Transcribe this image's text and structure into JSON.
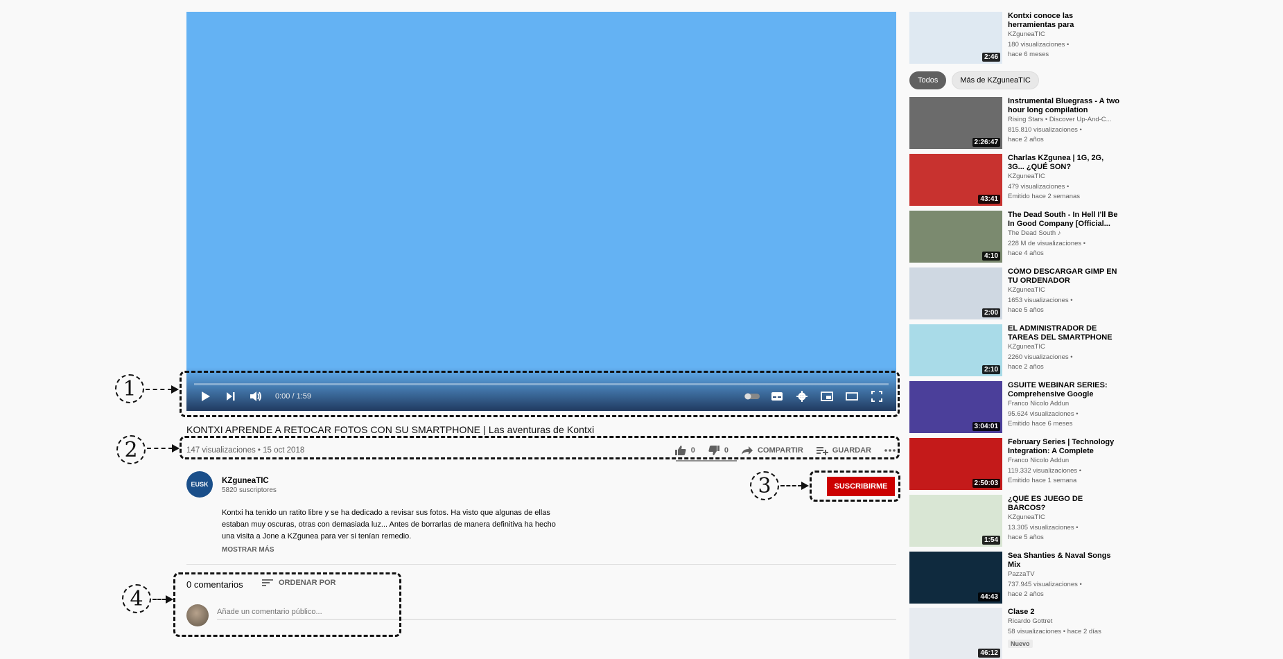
{
  "player": {
    "time": "0:00 / 1:59",
    "progress": 0
  },
  "video": {
    "title": "KONTXI APRENDE A RETOCAR FOTOS CON SU SMARTPHONE | Las aventuras de Kontxi",
    "views_date": "147 visualizaciones • 15 oct 2018",
    "likes": "0",
    "dislikes": "0",
    "share_label": "COMPARTIR",
    "save_label": "GUARDAR"
  },
  "channel": {
    "name": "KZguneaTIC",
    "subscribers": "5820 suscriptores",
    "avatar_text": "EUSK",
    "subscribe_label": "SUSCRIBIRME"
  },
  "description": {
    "text": "Kontxi ha tenido un ratito libre y se ha dedicado a revisar sus fotos. Ha visto que algunas de ellas estaban muy oscuras, otras con demasiada luz... Antes de borrarlas de manera definitiva ha hecho una visita a Jone a KZgunea para ver si tenían remedio.",
    "more_label": "MOSTRAR MÁS"
  },
  "comments": {
    "count_label": "0 comentarios",
    "sort_label": "ORDENAR POR",
    "placeholder": "Añade un comentario público..."
  },
  "annotations": [
    "1",
    "2",
    "3",
    "4"
  ],
  "chips": [
    "Todos",
    "Más de KZguneaTIC"
  ],
  "recommendations": [
    {
      "title": "Kontxi conoce las herramientas para comunicación no...",
      "channel": "KZguneaTIC",
      "views": "180 visualizaciones •",
      "age": "hace 6 meses",
      "duration": "2:46",
      "color": "#dfe9f2"
    },
    {
      "title": "Instrumental Bluegrass - A two hour long compilation",
      "channel": "Rising Stars • Discover Up-And-C...",
      "views": "815.810 visualizaciones •",
      "age": "hace 2 años",
      "duration": "2:26:47",
      "color": "#6b6b6b"
    },
    {
      "title": "Charlas KZgunea | 1G, 2G, 3G... ¿QUÉ SON?",
      "channel": "KZguneaTIC",
      "views": "479 visualizaciones •",
      "age": "Emitido hace 2 semanas",
      "duration": "43:41",
      "color": "#c8322f"
    },
    {
      "title": "The Dead South - In Hell I'll Be In Good Company [Official...",
      "channel": "The Dead South ♪",
      "views": "228 M de visualizaciones •",
      "age": "hace 4 años",
      "duration": "4:10",
      "color": "#7b8a6f"
    },
    {
      "title": "CÓMO DESCARGAR GIMP EN TU ORDENADOR",
      "channel": "KZguneaTIC",
      "views": "1653 visualizaciones •",
      "age": "hace 5 años",
      "duration": "2:00",
      "color": "#cfd8e2"
    },
    {
      "title": "EL ADMINISTRADOR DE TAREAS DEL SMARTPHONE |...",
      "channel": "KZguneaTIC",
      "views": "2260 visualizaciones •",
      "age": "hace 2 años",
      "duration": "2:10",
      "color": "#a9dbe8"
    },
    {
      "title": "GSUITE WEBINAR SERIES: Comprehensive Google Forms...",
      "channel": "Franco Nicolo Addun",
      "views": "95.624 visualizaciones •",
      "age": "Emitido hace 6 meses",
      "duration": "3:04:01",
      "color": "#4b3f9a"
    },
    {
      "title": "February Series | Technology Integration: A Complete Guide...",
      "channel": "Franco Nicolo Addun",
      "views": "119.332 visualizaciones •",
      "age": "Emitido hace 1 semana",
      "duration": "2:50:03",
      "color": "#c41a1a"
    },
    {
      "title": "¿QUÉ ES JUEGO DE BARCOS?",
      "channel": "KZguneaTIC",
      "views": "13.305 visualizaciones •",
      "age": "hace 5 años",
      "duration": "1:54",
      "color": "#d9e6d4"
    },
    {
      "title": "Sea Shanties & Naval Songs Mix",
      "channel": "PazzaTV",
      "views": "737.945 visualizaciones •",
      "age": "hace 2 años",
      "duration": "44:43",
      "color": "#0f2a3e"
    },
    {
      "title": "Clase 2",
      "channel": "Ricardo Gottret",
      "views": "58 visualizaciones • hace 2 días",
      "age": "",
      "badge": "Nuevo",
      "duration": "46:12",
      "color": "#e7ebf0"
    }
  ]
}
